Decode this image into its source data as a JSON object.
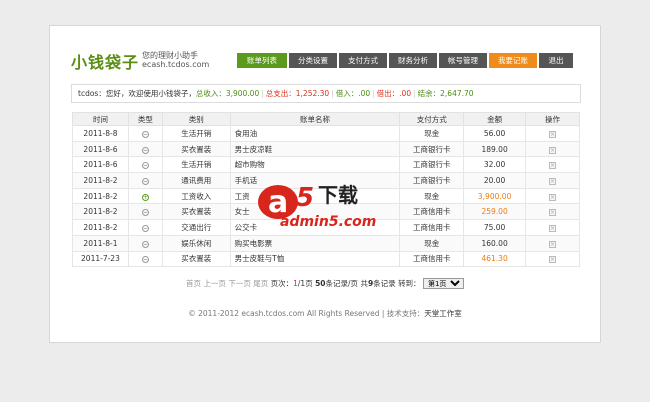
{
  "header": {
    "logo": "小钱袋子",
    "slogan_line1": "您的理财小助手",
    "slogan_line2": "ecash.tcdos.com"
  },
  "nav": [
    {
      "label": "账单列表",
      "style": "green"
    },
    {
      "label": "分类设置",
      "style": "dark"
    },
    {
      "label": "支付方式",
      "style": "dark"
    },
    {
      "label": "财务分析",
      "style": "dark"
    },
    {
      "label": "帐号管理",
      "style": "dark"
    },
    {
      "label": "我要记账",
      "style": "orange"
    },
    {
      "label": "退出",
      "style": "dark"
    }
  ],
  "status": {
    "greeting": "tcdos：您好，欢迎使用小钱袋子，",
    "income_label": "总收入：",
    "income_value": "3,900.00",
    "expense_label": "总支出：",
    "expense_value": "1,252.30",
    "lend_label": "借入：",
    "lend_value": ".00",
    "borrow_label": "借出：",
    "borrow_value": ".00",
    "balance_label": "结余：",
    "balance_value": "2,647.70"
  },
  "table": {
    "headers": [
      "时间",
      "类型",
      "类别",
      "账单名称",
      "支付方式",
      "金额",
      "操作"
    ],
    "rows": [
      {
        "date": "2011-8-8",
        "type": "minus",
        "category": "生活开销",
        "name": "食用油",
        "payment": "现金",
        "amount": "56.00",
        "highlight": false
      },
      {
        "date": "2011-8-6",
        "type": "minus",
        "category": "买衣置装",
        "name": "男士皮凉鞋",
        "payment": "工商银行卡",
        "amount": "189.00",
        "highlight": false
      },
      {
        "date": "2011-8-6",
        "type": "minus",
        "category": "生活开销",
        "name": "超市购物",
        "payment": "工商银行卡",
        "amount": "32.00",
        "highlight": false
      },
      {
        "date": "2011-8-2",
        "type": "minus",
        "category": "通讯费用",
        "name": "手机话",
        "payment": "工商银行卡",
        "amount": "20.00",
        "highlight": false
      },
      {
        "date": "2011-8-2",
        "type": "plus",
        "category": "工资收入",
        "name": "工资",
        "payment": "现金",
        "amount": "3,900.00",
        "highlight": true
      },
      {
        "date": "2011-8-2",
        "type": "minus",
        "category": "买衣置装",
        "name": "女士",
        "payment": "工商信用卡",
        "amount": "259.00",
        "highlight": true
      },
      {
        "date": "2011-8-2",
        "type": "minus",
        "category": "交通出行",
        "name": "公交卡",
        "payment": "工商信用卡",
        "amount": "75.00",
        "highlight": false
      },
      {
        "date": "2011-8-1",
        "type": "minus",
        "category": "娱乐休闲",
        "name": "购买电影票",
        "payment": "现金",
        "amount": "160.00",
        "highlight": false
      },
      {
        "date": "2011-7-23",
        "type": "minus",
        "category": "买衣置装",
        "name": "男士皮鞋与T恤",
        "payment": "工商信用卡",
        "amount": "461.30",
        "highlight": true
      }
    ]
  },
  "pager": {
    "first": "首页",
    "prev": "上一页",
    "next": "下一页",
    "last": "尾页",
    "page_label": "页次：",
    "page_current": "1",
    "page_total": "/1页",
    "per_page_value": "50",
    "per_page_label": "条记录/页",
    "total_label": "共",
    "total_value": "9",
    "total_unit": "条记录",
    "jump_label": "转到：",
    "jump_option": "第1页"
  },
  "footer": {
    "text": "© 2011-2012 ecash.tcdos.com All Rights Reserved | 技术支持：",
    "studio": "天堂工作室"
  },
  "watermark": {
    "brand_char": "a",
    "brand_num": "5",
    "brand_text": "下载",
    "domain": "admin5.com"
  },
  "colors": {
    "green": "#5b9a1c",
    "orange": "#f08a1a",
    "dark_nav": "#555555"
  }
}
